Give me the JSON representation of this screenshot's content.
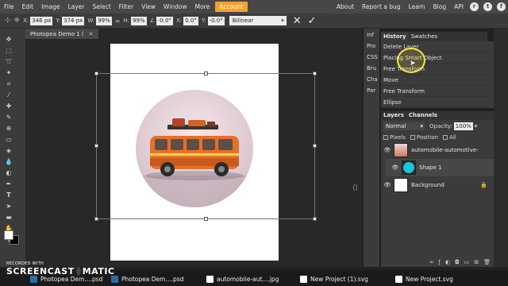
{
  "menubar": {
    "items": [
      "File",
      "Edit",
      "Image",
      "Layer",
      "Select",
      "Filter",
      "View",
      "Window",
      "More"
    ],
    "account": "Account",
    "right_links": [
      "About",
      "Report a bug",
      "Learn",
      "Blog",
      "API"
    ],
    "account_color": "#f6a02a"
  },
  "options": {
    "x_label": "X:",
    "x_value": "346 px",
    "y_label": "Y:",
    "y_value": "374 px",
    "w_label": "W:",
    "w_value": "99%",
    "h_label": "H:",
    "h_value": "99%",
    "rot_value": "-0.0°",
    "skx_label": "X:",
    "skx_value": "0.0°",
    "sky_label": "Y:",
    "sky_value": "-0.0°",
    "interp": "Bilinear"
  },
  "document": {
    "tab_title": "Photopea Demo 1 (",
    "close_icon": "close-icon"
  },
  "mini_panels": [
    "Inf",
    "Pro",
    "CSS",
    "Bru",
    "Cha",
    "Par"
  ],
  "history": {
    "tabs": [
      "History",
      "Swatches"
    ],
    "items": [
      "Delete Layer",
      "Placing Smart Object",
      "Free Transform",
      "Move",
      "Free Transform",
      "Ellipse"
    ]
  },
  "layers": {
    "tabs": [
      "Layers",
      "Channels"
    ],
    "blend_mode": "Normal",
    "opacity_label": "Opacity:",
    "opacity_value": "100%",
    "lock_options": [
      "Pixels",
      "Position",
      "All"
    ],
    "items": [
      {
        "name": "automobile-automotive-",
        "thumb_color": "#d47a5a"
      },
      {
        "name": "Shape 1",
        "thumb_color": "#19c6d8"
      },
      {
        "name": "Background",
        "thumb_color": "#ffffff"
      }
    ]
  },
  "taskbar": {
    "watermark_top": "RECORDED WITH",
    "watermark_brand": "SCREENCAST",
    "watermark_tail": "MATIC",
    "items": [
      "Photopea Dem....psd",
      "Photopea Dem....psd",
      "automobile-aut....jpg",
      "New Project (1).svg",
      "New Project.svg"
    ]
  }
}
